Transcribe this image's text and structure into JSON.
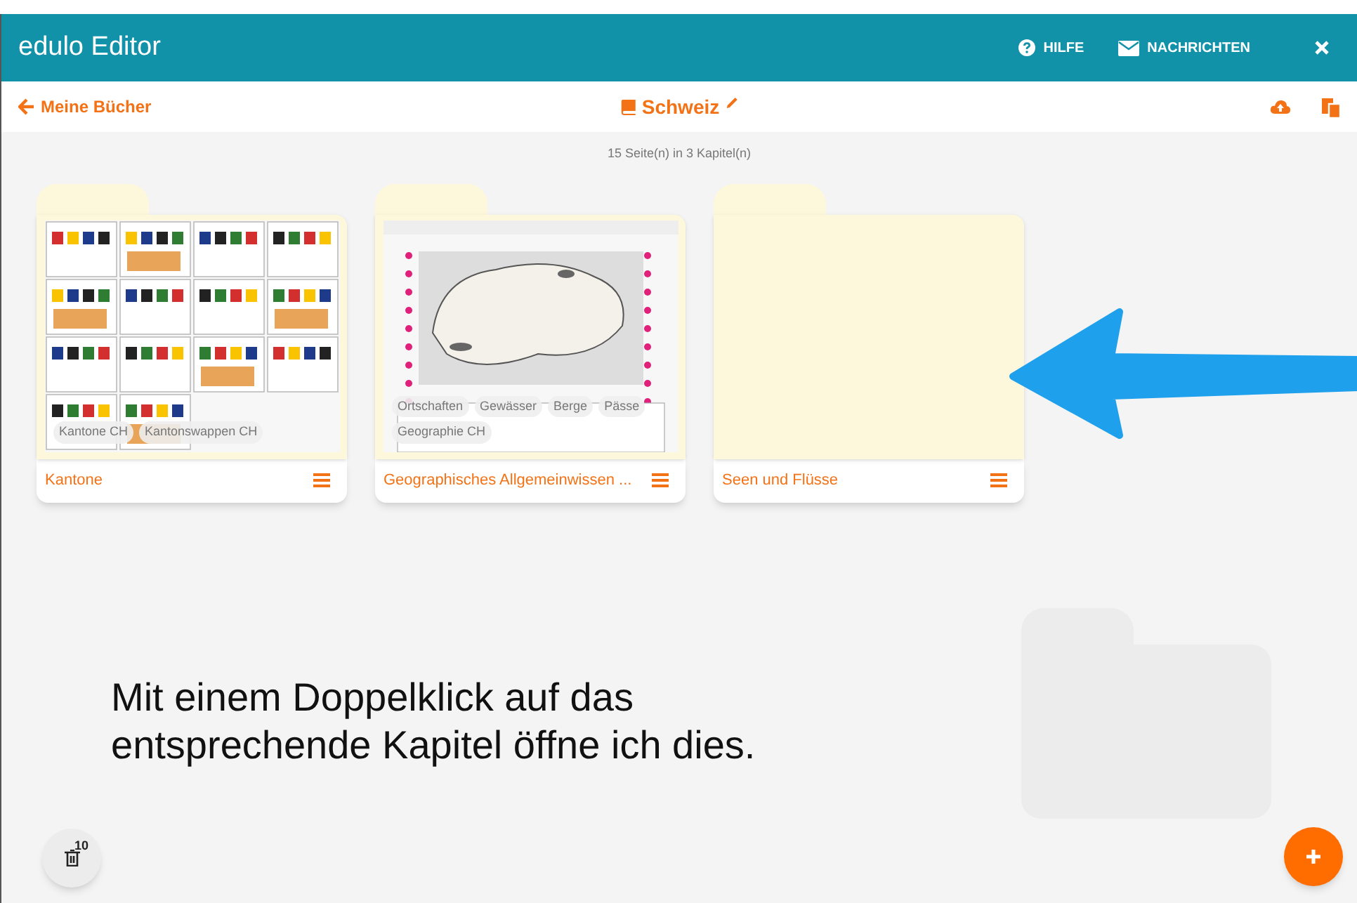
{
  "header": {
    "title": "edulo Editor",
    "actions": [
      {
        "kind": "help",
        "label": "HILFE"
      },
      {
        "kind": "mail",
        "label": "NACHRICHTEN"
      },
      {
        "kind": "close"
      }
    ]
  },
  "toolbar": {
    "back": "Meine Bücher",
    "book_title": "Schweiz"
  },
  "summary": "15 Seite(n) in 3 Kapitel(n)",
  "chapters": [
    {
      "title": "Kantone",
      "preview": {
        "kind": "picture",
        "tags": [
          "Kantone CH",
          "Kantonswappen CH"
        ]
      }
    },
    {
      "title": "Geographisches Allgemeinwissen ...",
      "preview": {
        "kind": "picture",
        "tags": [
          "Ortschaften",
          "Gewässer",
          "Berge",
          "Pässe",
          "Geographie CH"
        ]
      }
    },
    {
      "title": "Seen und Flüsse"
    }
  ],
  "caption": "Mit einem Doppelklick auf das entsprechende Kapitel öffne ich dies.",
  "trash": {
    "count": "10"
  }
}
